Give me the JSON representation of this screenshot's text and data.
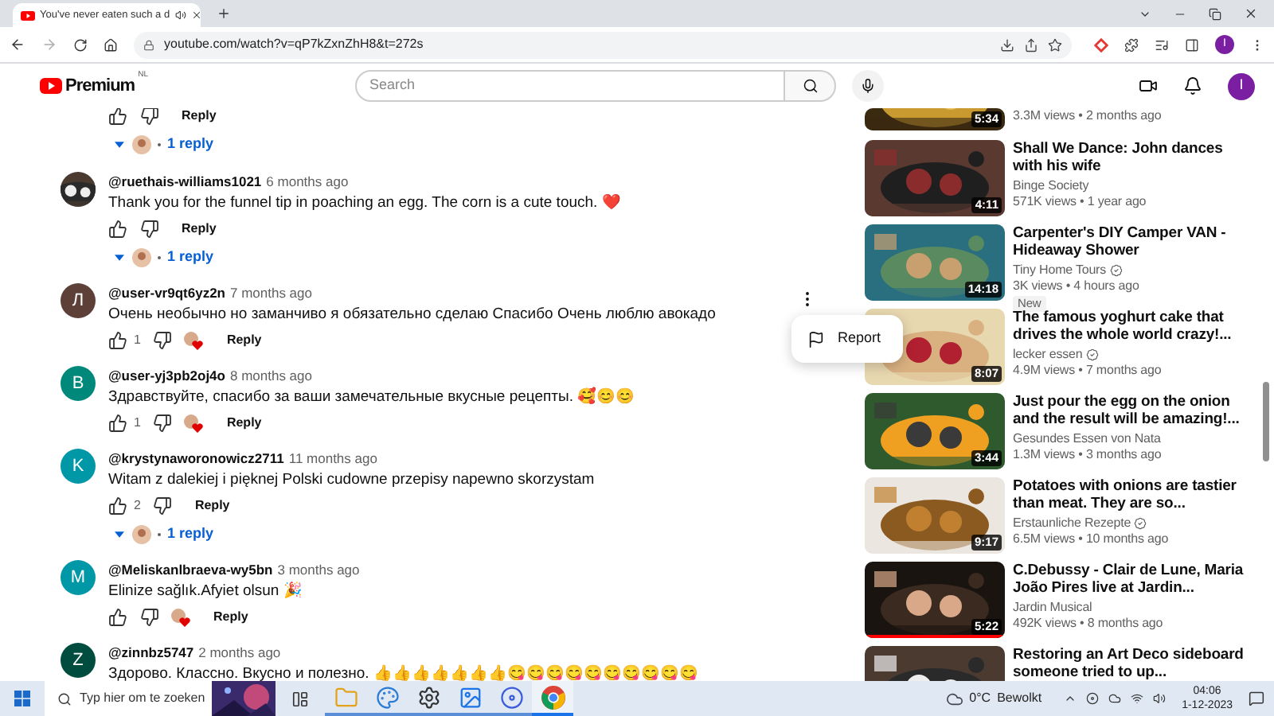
{
  "browser": {
    "tab": {
      "title": "You've never eaten such a d",
      "playing_audio": true
    },
    "address": "youtube.com/watch?v=qP7kZxnZhH8&t=272s",
    "profile_initial": "I"
  },
  "header": {
    "logo": "Premium",
    "region": "NL",
    "search": {
      "placeholder": "Search"
    },
    "avatar_initial": "I"
  },
  "thread_top": {
    "reply_label": "Reply",
    "replies": "1 reply"
  },
  "comments": [
    {
      "author": "@ruethais-williams1021",
      "time": "6 months ago",
      "text": "Thank you for the funnel tip in poaching an egg. The corn is a cute touch. ❤️",
      "hearted": false,
      "reply_label": "Reply",
      "replies": "1 reply"
    },
    {
      "author": "@user-vr9qt6yz2n",
      "time": "7 months ago",
      "text": "Очень необычно но заманчиво я обязательно сделаю Спасибо Очень люблю авокадо",
      "avatar": {
        "kind": "letter",
        "initial": "Л",
        "color": "#5d4037"
      },
      "likes": "1",
      "hearted": true,
      "reply_label": "Reply",
      "menu": {
        "items": [
          {
            "label": "Report"
          }
        ]
      }
    },
    {
      "author": "@user-yj3pb2oj4o",
      "time": "8 months ago",
      "text": "Здравствуйте, спасибо за ваши замечательные вкусные рецепты. 🥰😊😊",
      "avatar": {
        "kind": "letter",
        "initial": "В",
        "color": "#00897b"
      },
      "likes": "1",
      "hearted": true,
      "reply_label": "Reply"
    },
    {
      "author": "@krystynaworonowicz2711",
      "time": "11 months ago",
      "text": "Witam z dalekiej i pięknej Polski cudowne przepisy napewno skorzystam",
      "avatar": {
        "kind": "letter",
        "initial": "K",
        "color": "#0097a7"
      },
      "likes": "2",
      "hearted": false,
      "reply_label": "Reply",
      "replies": "1 reply"
    },
    {
      "author": "@Meliskanlbraeva-wy5bn",
      "time": "3 months ago",
      "text": "Elinize sağlık.Afyiet olsun 🎉",
      "avatar": {
        "kind": "letter",
        "initial": "M",
        "color": "#0097a7"
      },
      "hearted": true,
      "reply_label": "Reply"
    },
    {
      "author": "@zinnbz5747",
      "time": "2 months ago",
      "text": "Здорово. Классно. Вкусно и полезно. 👍👍👍👍👍👍👍😋😋😋😋😋😋😋😋😋😋",
      "avatar": {
        "kind": "letter",
        "initial": "Z",
        "color": "#004d40"
      }
    }
  ],
  "videos": [
    {
      "meta": "3.3M views • 2 months ago",
      "duration": "5:34"
    },
    {
      "title": "Shall We Dance: John dances with his wife",
      "channel": "Binge Society",
      "verified": false,
      "meta": "571K views • 1 year ago",
      "duration": "4:11"
    },
    {
      "title": "Carpenter's DIY Camper VAN - Hideaway Shower",
      "channel": "Tiny Home Tours",
      "verified": true,
      "meta": "3K views • 4 hours ago",
      "badge": "New",
      "duration": "14:18"
    },
    {
      "title": "The famous yoghurt cake that drives the whole world crazy!...",
      "channel": "lecker essen",
      "verified": true,
      "meta": "4.9M views • 7 months ago",
      "duration": "8:07"
    },
    {
      "title": "Just pour the egg on the onion and the result will be amazing!...",
      "channel": "Gesundes Essen von Nata",
      "verified": false,
      "meta": "1.3M views • 3 months ago",
      "duration": "3:44"
    },
    {
      "title": "Potatoes with onions are tastier than meat. They are so...",
      "channel": "Erstaunliche Rezepte",
      "verified": true,
      "meta": "6.5M views • 10 months ago",
      "duration": "9:17"
    },
    {
      "title": "C.Debussy - Clair de Lune, Maria João Pires live at Jardin...",
      "channel": "Jardin Musical",
      "verified": false,
      "meta": "492K views • 8 months ago",
      "duration": "5:22",
      "level": 1
    },
    {
      "title": "Restoring an Art Deco sideboard someone tried to up..."
    }
  ],
  "taskbar": {
    "search": {
      "placeholder": "Typ hier om te zoeken"
    },
    "apps": [
      {
        "kind": "explorer",
        "selected": false
      },
      {
        "kind": "paint",
        "selected": false
      },
      {
        "kind": "settings",
        "selected": false
      },
      {
        "kind": "photos",
        "selected": false
      },
      {
        "kind": "circle",
        "selected": false
      },
      {
        "kind": "chrome",
        "selected": true
      }
    ],
    "weather": {
      "temperature": "0°C",
      "condition": "Bewolkt"
    },
    "time": "04:06",
    "date": "1-12-2023"
  }
}
